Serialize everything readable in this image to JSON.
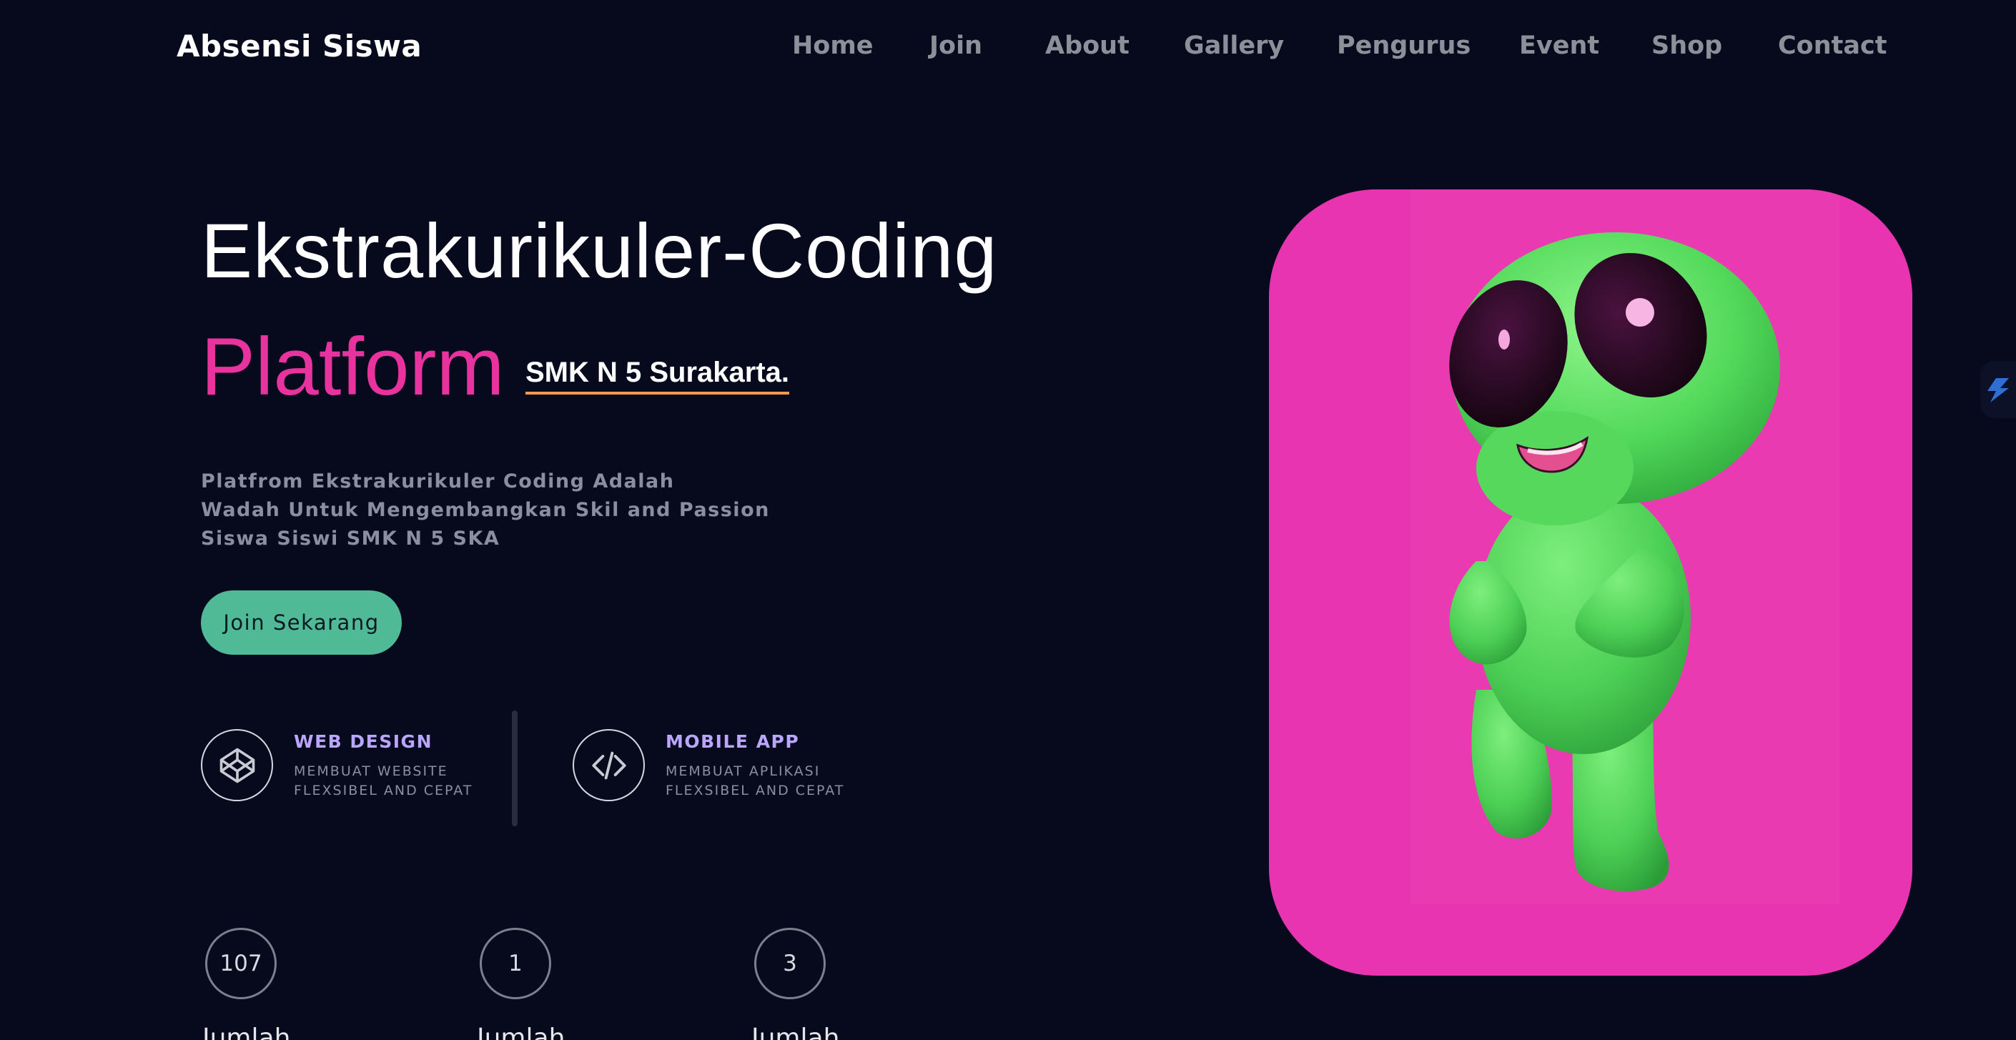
{
  "header": {
    "brand": "Absensi Siswa",
    "nav": [
      "Home",
      "Join",
      "About",
      "Gallery",
      "Pengurus",
      "Event",
      "Shop",
      "Contact"
    ]
  },
  "hero": {
    "title": "Ekstrakurikuler-Coding",
    "subtitle": "Platform",
    "school": "SMK N 5 Surakarta.",
    "description": [
      "Platfrom Ekstrakurikuler Coding Adalah",
      "Wadah Untuk Mengembangkan Skil and Passion",
      "Siswa Siswi SMK N 5 SKA"
    ],
    "cta": "Join Sekarang"
  },
  "services": [
    {
      "icon": "codepen-icon",
      "title": "WEB DESIGN",
      "desc": [
        "MEMBUAT WEBSITE",
        "FLEXSIBEL AND CEPAT"
      ]
    },
    {
      "icon": "code-icon",
      "title": "MOBILE APP",
      "desc": [
        "MEMBUAT APLIKASI",
        "FLEXSIBEL AND CEPAT"
      ]
    }
  ],
  "stats": [
    {
      "value": "107",
      "label": "Jumlah"
    },
    {
      "value": "1",
      "label": "Jumlah"
    },
    {
      "value": "3",
      "label": "Jumlah"
    }
  ],
  "colors": {
    "background": "#070a1d",
    "accent_pink": "#e8339f",
    "card_pink": "#e834b0",
    "button_green": "#50b996",
    "service_title": "#bba6ff",
    "underline_orange": "#f29a4c"
  }
}
